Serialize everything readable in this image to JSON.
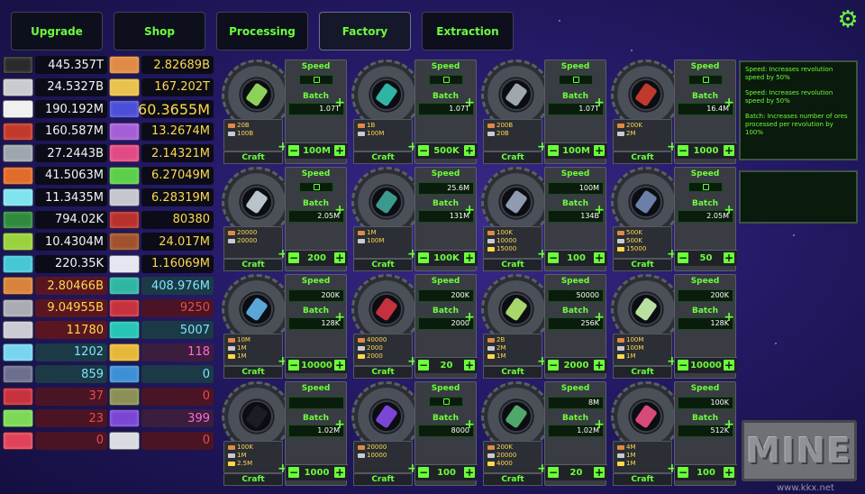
{
  "tabs": [
    "Upgrade",
    "Shop",
    "Processing",
    "Factory",
    "Extraction"
  ],
  "active_tab": "Factory",
  "settings_icon": "gear-icon",
  "inventory_left": [
    {
      "value": "445.357T",
      "color": "#2b2b2e"
    },
    {
      "value": "24.5327B",
      "color": "#c9cbd0"
    },
    {
      "value": "190.192M",
      "color": "#f0f0f0"
    },
    {
      "value": "160.587M",
      "color": "#c0392b"
    },
    {
      "value": "27.2443B",
      "color": "#9ea6ae"
    },
    {
      "value": "41.5063M",
      "color": "#e06b2a"
    },
    {
      "value": "11.3435M",
      "color": "#7fe3f0"
    },
    {
      "value": "794.02K",
      "color": "#2f8a3d"
    },
    {
      "value": "10.4304M",
      "color": "#9bd13c"
    },
    {
      "value": "220.35K",
      "color": "#45c7d6"
    },
    {
      "value": "2.80466B",
      "color": "#d8833b"
    },
    {
      "value": "9.04955B",
      "color": "#a9adb3"
    },
    {
      "value": "11780",
      "color": "#c9cdd3"
    },
    {
      "value": "1202",
      "color": "#78d5ef"
    },
    {
      "value": "859",
      "color": "#6d6f8e"
    },
    {
      "value": "37",
      "color": "#c7303d"
    },
    {
      "value": "23",
      "color": "#7cd957"
    },
    {
      "value": "0",
      "color": "#e0425a"
    }
  ],
  "inventory_right": [
    {
      "value": "2.82689B",
      "color": "#e08a45"
    },
    {
      "value": "167.202T",
      "color": "#e8c24a"
    },
    {
      "value": "60.3655M",
      "color": "#4b4ed6"
    },
    {
      "value": "13.2674M",
      "color": "#a45fd6"
    },
    {
      "value": "2.14321M",
      "color": "#e24a86"
    },
    {
      "value": "6.27049M",
      "color": "#5bcf4a"
    },
    {
      "value": "6.28319M",
      "color": "#c4c8ce"
    },
    {
      "value": "80380",
      "color": "#b8312c"
    },
    {
      "value": "24.017M",
      "color": "#a0522d"
    },
    {
      "value": "1.16069M",
      "color": "#e4e6f0"
    },
    {
      "value": "408.976M",
      "color": "#2fb5a4"
    },
    {
      "value": "9250",
      "color": "#c7303d"
    },
    {
      "value": "5007",
      "color": "#27c4b8"
    },
    {
      "value": "118",
      "color": "#e6b83a"
    },
    {
      "value": "0",
      "color": "#3d8fd6"
    },
    {
      "value": "0",
      "color": "#8a8f54"
    },
    {
      "value": "399",
      "color": "#7a46d6"
    },
    {
      "value": "0",
      "color": "#d8dce2"
    }
  ],
  "machines": [
    {
      "speed_locked": true,
      "batch": "1.07T",
      "amount": "100M",
      "inputs": [
        "20B",
        "100B"
      ],
      "item_color": "#8ed15a"
    },
    {
      "speed_locked": true,
      "batch": "1.07T",
      "amount": "500K",
      "inputs": [
        "1B",
        "100M"
      ],
      "item_color": "#2fb5a4"
    },
    {
      "speed_locked": true,
      "batch": "1.07T",
      "amount": "100M",
      "inputs": [
        "200B",
        "20B"
      ],
      "item_color": "#9ea6ae"
    },
    {
      "speed_locked": true,
      "batch": "16.4M",
      "amount": "1000",
      "inputs": [
        "200K",
        "2M"
      ],
      "item_color": "#c0392b"
    },
    {
      "speed_locked": true,
      "batch": "2.05M",
      "amount": "200",
      "inputs": [
        "20000",
        "20000"
      ],
      "item_color": "#b9c3cc"
    },
    {
      "speed": "25.6M",
      "batch": "131M",
      "amount": "100K",
      "inputs": [
        "1M",
        "100M"
      ],
      "item_color": "#3b9a8e"
    },
    {
      "speed": "100M",
      "batch": "134B",
      "amount": "100",
      "inputs": [
        "100K",
        "10000",
        "15000"
      ],
      "item_color": "#8f9bb0"
    },
    {
      "speed_locked": true,
      "batch": "2.05M",
      "amount": "50",
      "inputs": [
        "500K",
        "500K",
        "15000"
      ],
      "item_color": "#6b7fa8"
    },
    {
      "speed": "200K",
      "batch": "128K",
      "amount": "10000",
      "inputs": [
        "10M",
        "1M",
        "1M"
      ],
      "item_color": "#5aa6d6"
    },
    {
      "speed": "200K",
      "batch": "2000",
      "amount": "20",
      "inputs": [
        "40000",
        "2000",
        "2000"
      ],
      "item_color": "#c7303d"
    },
    {
      "speed": "50000",
      "batch": "256K",
      "amount": "2000",
      "inputs": [
        "2B",
        "2M",
        "1M"
      ],
      "item_color": "#a8d66a"
    },
    {
      "speed": "200K",
      "batch": "128K",
      "amount": "10000",
      "inputs": [
        "100M",
        "100M",
        "1M"
      ],
      "item_color": "#b8e0a0"
    },
    {
      "speed": "",
      "batch": "1.02M",
      "amount": "1000",
      "inputs": [
        "100K",
        "1M",
        "2.5M"
      ],
      "item_color": "#1b1d22"
    },
    {
      "speed_locked": true,
      "batch": "8000",
      "amount": "100",
      "inputs": [
        "20000",
        "10000"
      ],
      "item_color": "#7a46d6"
    },
    {
      "speed": "8M",
      "batch": "1.02M",
      "amount": "20",
      "inputs": [
        "200K",
        "20000",
        "4000"
      ],
      "item_color": "#4fa86a"
    },
    {
      "speed": "100K",
      "batch": "512K",
      "amount": "100",
      "inputs": [
        "4M",
        "1M",
        "1M"
      ],
      "item_color": "#d84a7a"
    }
  ],
  "labels": {
    "speed": "Speed",
    "batch": "Batch",
    "craft": "Craft",
    "plus": "+",
    "minus": "−"
  },
  "info_panel": {
    "line1": "Speed: Increases revolution speed by 50%",
    "line2": "Speed: Increases revolution speed by 50%",
    "line3": "Batch: Increases number of ores processed per revolution by 100%"
  },
  "mine_button": "MINE",
  "watermark": "www.kkx.net"
}
